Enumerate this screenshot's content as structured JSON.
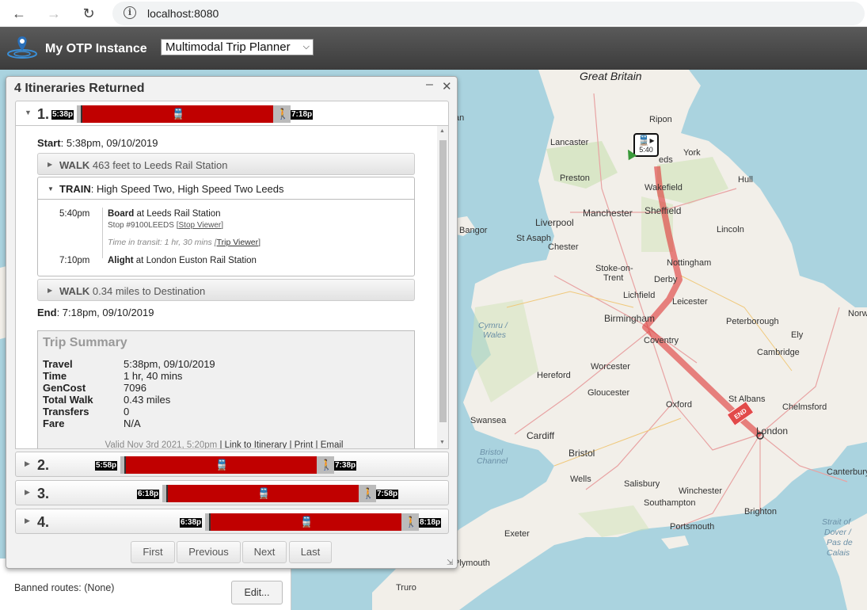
{
  "browser": {
    "url": "localhost:8080",
    "back_icon": "arrow-left-icon",
    "forward_icon": "arrow-right-icon",
    "reload_icon": "reload-icon"
  },
  "app": {
    "title": "My OTP Instance",
    "mode": "Multimodal Trip Planner"
  },
  "panel": {
    "title": "4 Itineraries Returned",
    "itineraries": [
      {
        "num": "1.",
        "start": "5:38p",
        "end": "7:18p"
      },
      {
        "num": "2.",
        "start": "5:58p",
        "end": "7:38p"
      },
      {
        "num": "3.",
        "start": "6:18p",
        "end": "7:58p"
      },
      {
        "num": "4.",
        "start": "6:38p",
        "end": "8:18p"
      }
    ],
    "detail": {
      "start_label": "Start",
      "start_value": ": 5:38pm, 09/10/2019",
      "walk1_mode": "WALK",
      "walk1_text": "463 feet to Leeds Rail Station",
      "train_mode": "TRAIN",
      "train_text": ": High Speed Two, High Speed Two Leeds",
      "board_time": "5:40pm",
      "board_label": "Board",
      "board_text": "at Leeds Rail Station",
      "board_stop": "Stop #9100LEEDS [",
      "stop_viewer": "Stop Viewer",
      "close_bracket": "]",
      "transit_time": "Time in transit: 1 hr, 30 mins [",
      "trip_viewer": "Trip Viewer",
      "alight_time": "7:10pm",
      "alight_label": "Alight",
      "alight_text": "at London Euston Rail Station",
      "walk2_mode": "WALK",
      "walk2_text": "0.34 miles to Destination",
      "end_label": "End",
      "end_value": ": 7:18pm, 09/10/2019"
    },
    "summary": {
      "title": "Trip Summary",
      "rows": [
        {
          "k": "Travel",
          "v": "5:38pm, 09/10/2019"
        },
        {
          "k": "Time",
          "v": "1 hr, 40 mins"
        },
        {
          "k": "GenCost",
          "v": "7096"
        },
        {
          "k": "Total Walk",
          "v": "0.43 miles"
        },
        {
          "k": "Transfers",
          "v": "0"
        },
        {
          "k": "Fare",
          "v": "N/A"
        }
      ],
      "valid": "Valid Nov 3rd 2021, 5:20pm",
      "sep": " | ",
      "link": "Link to Itinerary",
      "print": "Print",
      "email": "Email"
    },
    "pager": {
      "first": "First",
      "previous": "Previous",
      "next": "Next",
      "last": "Last"
    }
  },
  "options": {
    "banned": "Banned routes: (None)",
    "edit": "Edit..."
  },
  "map": {
    "country": "Great Britain",
    "start_marker_time": "5:40",
    "end_marker_label": "END",
    "cities": {
      "ripon": "Ripon",
      "lancaster": "Lancaster",
      "york": "York",
      "leeds": "eds",
      "preston": "Preston",
      "hull": "Hull",
      "wakefield": "Wakefield",
      "manchester": "Manchester",
      "sheffield": "Sheffield",
      "liverpool": "Liverpool",
      "bangor": "Bangor",
      "stasaph": "St Asaph",
      "lincoln": "Lincoln",
      "chester": "Chester",
      "nottingham": "Nottingham",
      "stoke": "Stoke-on-",
      "trent": "Trent",
      "derby": "Derby",
      "lichfield": "Lichfield",
      "leicester": "Leicester",
      "birmingham": "Birmingham",
      "peterborough": "Peterborough",
      "norwich": "Norw",
      "ely": "Ely",
      "coventry": "Coventry",
      "cymru": "Cymru /",
      "wales": "Wales",
      "cambridge": "Cambridge",
      "worcester": "Worcester",
      "hereford": "Hereford",
      "gloucester": "Gloucester",
      "oxford": "Oxford",
      "stalbans": "St Albans",
      "chelmsford": "Chelmsford",
      "swansea": "Swansea",
      "cardiff": "Cardiff",
      "london": "London",
      "bristol": "Bristol",
      "bristol_channel": "Bristol",
      "channel": "Channel",
      "wells": "Wells",
      "salisbury": "Salisbury",
      "winchester": "Winchester",
      "canterbury": "Canterbury",
      "southampton": "Southampton",
      "portsmouth": "Portsmouth",
      "brighton": "Brighton",
      "exeter": "Exeter",
      "plymouth": "Plymouth",
      "truro": "Truro",
      "strait1": "Strait of",
      "strait2": "Dover /",
      "strait3": "Pas de",
      "strait4": "Calais",
      "an": "an"
    }
  }
}
